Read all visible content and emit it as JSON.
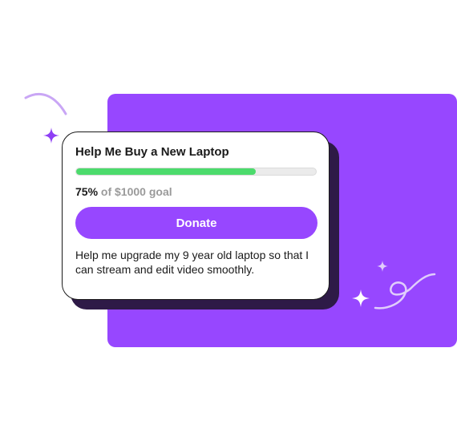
{
  "campaign": {
    "title": "Help Me Buy a New Laptop",
    "progress_percent": 75,
    "percent_label": "75%",
    "goal_label": "of $1000 goal",
    "donate_label": "Donate",
    "description": "Help me upgrade my 9 year old laptop so that I can stream and edit video smoothly."
  },
  "colors": {
    "brand_purple": "#9747ff",
    "card_shadow": "#2e1a47",
    "progress_green": "#4cdb6c",
    "sparkle_purple": "#8e3ff5",
    "sparkle_light": "#ffffff",
    "swirl_lavender": "#c9a6f5"
  },
  "decorations": {
    "sparkle_icon": "four-point-star",
    "swirl_icon": "curly-swirl"
  }
}
